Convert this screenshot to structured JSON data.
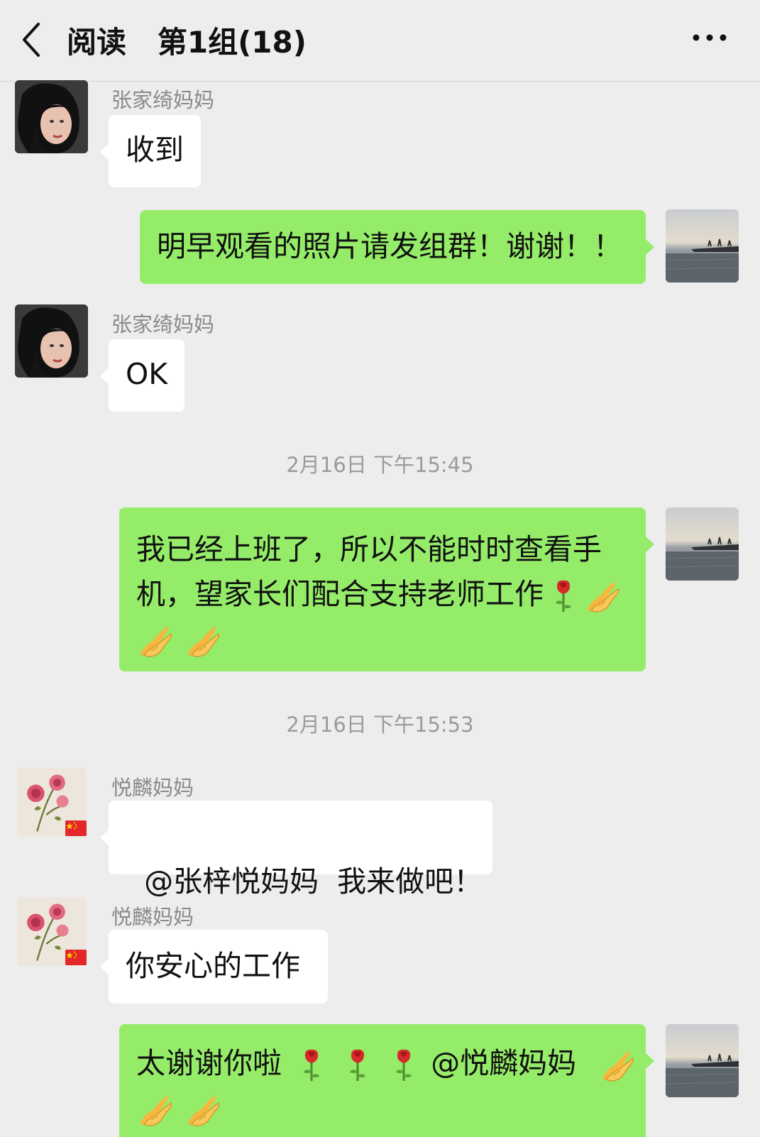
{
  "header": {
    "title": "阅读   第1组(18)"
  },
  "messages": {
    "m1": {
      "sender": "张家绮妈妈",
      "text": "收到"
    },
    "m2": {
      "text": "明早观看的照片请发组群！谢谢！！"
    },
    "m3": {
      "sender": "张家绮妈妈",
      "text": "OK"
    },
    "t1": "2月16日 下午15:45",
    "m4": {
      "line1": "我已经上班了，所以不能时时查看手",
      "line2": "机，望家长们配合支持老师工作"
    },
    "t2": "2月16日 下午15:53",
    "m5": {
      "sender": "悦麟妈妈",
      "text": "@张梓悦妈妈  我来做吧！"
    },
    "m6": {
      "sender": "悦麟妈妈",
      "text": "你安心的工作"
    },
    "m7": {
      "text_a": "太谢谢你啦",
      "text_b": "@悦麟妈妈"
    }
  },
  "icons": {
    "back": "chevron-left-icon",
    "more": "more-dots-icon",
    "rose": "rose-emoji",
    "hands": "folded-hands-emoji",
    "flag": "china-flag-icon"
  }
}
